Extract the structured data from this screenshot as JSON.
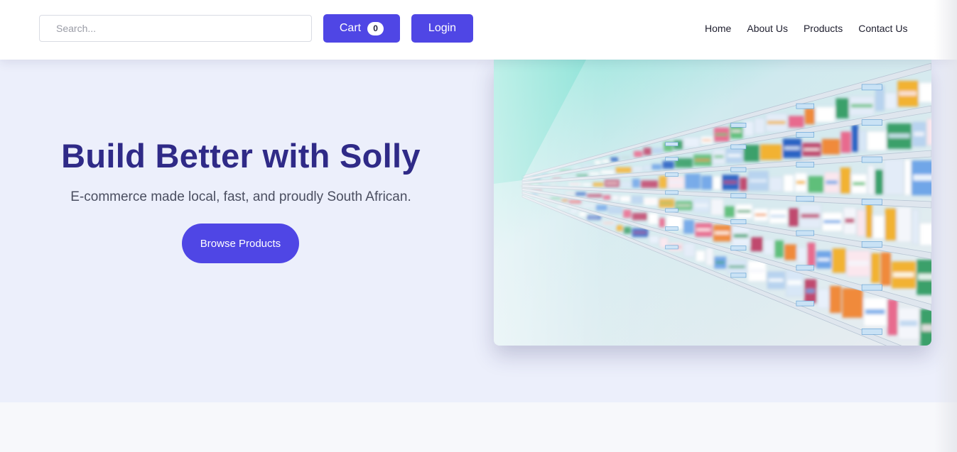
{
  "header": {
    "search_placeholder": "Search...",
    "cart_label": "Cart",
    "cart_count": "0",
    "login_label": "Login",
    "nav": [
      {
        "label": "Home"
      },
      {
        "label": "About Us"
      },
      {
        "label": "Products"
      },
      {
        "label": "Contact Us"
      }
    ]
  },
  "hero": {
    "title": "Build Better with Solly",
    "subtitle": "E-commerce made local, fast, and proudly South African.",
    "cta_label": "Browse Products",
    "image_subject": "pharmacy-shelves-photo"
  },
  "colors": {
    "accent": "#4f46e5",
    "title": "#2f2a87",
    "hero_bg": "#eceffb",
    "page_bg": "#f7f8fb"
  }
}
